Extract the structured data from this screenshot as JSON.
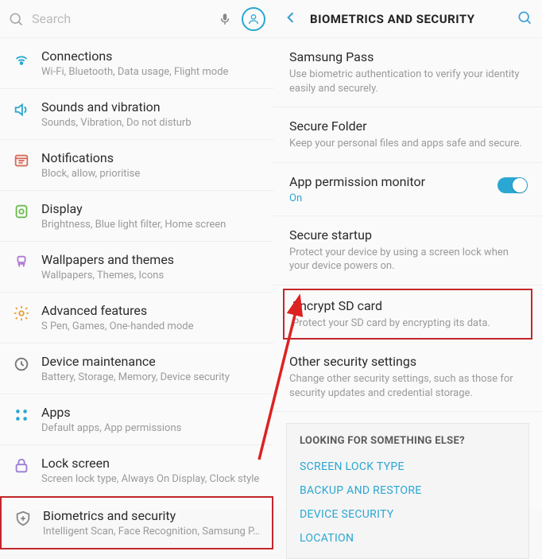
{
  "left": {
    "search_placeholder": "Search",
    "items": [
      {
        "icon": "connections-icon",
        "title": "Connections",
        "sub": "Wi-Fi, Bluetooth, Data usage, Flight mode"
      },
      {
        "icon": "sound-icon",
        "title": "Sounds and vibration",
        "sub": "Sounds, Vibration, Do not disturb"
      },
      {
        "icon": "notifications-icon",
        "title": "Notifications",
        "sub": "Block, allow, prioritise"
      },
      {
        "icon": "display-icon",
        "title": "Display",
        "sub": "Brightness, Blue light filter, Home screen"
      },
      {
        "icon": "wallpaper-icon",
        "title": "Wallpapers and themes",
        "sub": "Wallpapers, Themes, Icons"
      },
      {
        "icon": "advanced-icon",
        "title": "Advanced features",
        "sub": "S Pen, Games, One-handed mode"
      },
      {
        "icon": "maintenance-icon",
        "title": "Device maintenance",
        "sub": "Battery, Storage, Memory, Device security"
      },
      {
        "icon": "apps-icon",
        "title": "Apps",
        "sub": "Default apps, App permissions"
      },
      {
        "icon": "lockscreen-icon",
        "title": "Lock screen",
        "sub": "Screen lock type, Always On Display, Clock style"
      },
      {
        "icon": "biometrics-icon",
        "title": "Biometrics and security",
        "sub": "Intelligent Scan, Face Recognition, Samsung P…",
        "highlighted": true
      }
    ]
  },
  "right": {
    "header_title": "BIOMETRICS AND SECURITY",
    "items": [
      {
        "title": "Samsung Pass",
        "sub": "Use biometric authentication to verify your identity easily and securely."
      },
      {
        "title": "Secure Folder",
        "sub": "Keep your personal files and apps safe and secure."
      },
      {
        "title": "App permission monitor",
        "status": "On",
        "toggle": true
      },
      {
        "title": "Secure startup",
        "sub": "Protect your device by using a screen lock when your device powers on."
      },
      {
        "title": "Encrypt SD card",
        "sub": "Protect your SD card by encrypting its data.",
        "highlighted": true
      },
      {
        "title": "Other security settings",
        "sub": "Change other security settings, such as those for security updates and credential storage."
      }
    ],
    "related": {
      "heading": "LOOKING FOR SOMETHING ELSE?",
      "links": [
        "SCREEN LOCK TYPE",
        "BACKUP AND RESTORE",
        "DEVICE SECURITY",
        "LOCATION"
      ]
    }
  }
}
